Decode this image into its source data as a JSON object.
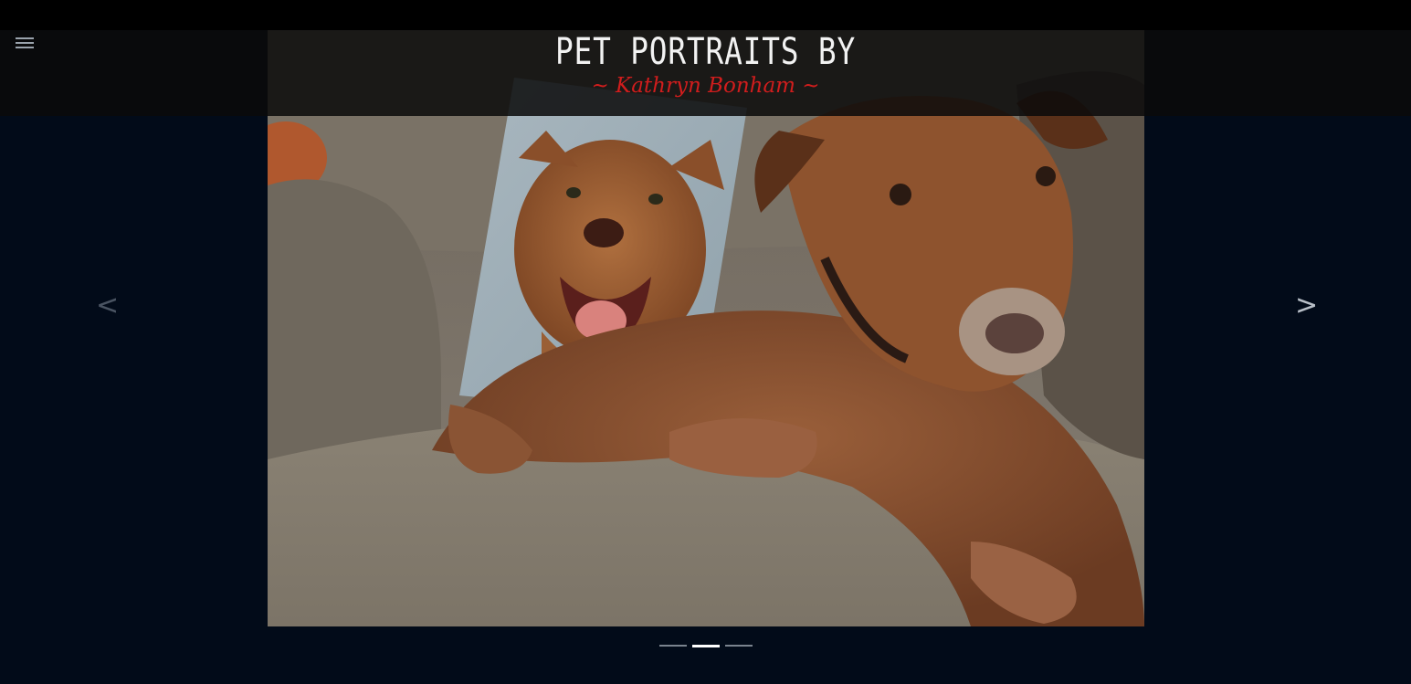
{
  "header": {
    "title": "PET PORTRAITS BY",
    "subtitle": "~ Kathryn Bonham ~",
    "menu_icon": "hamburger-menu-icon"
  },
  "slider": {
    "prev_label": "<",
    "next_label": ">",
    "slide_count": 3,
    "active_index": 1
  },
  "colors": {
    "background": "#020b19",
    "header_bar": "#0a0a0a",
    "title": "#f2f2f2",
    "subtitle": "#d11d1d"
  }
}
